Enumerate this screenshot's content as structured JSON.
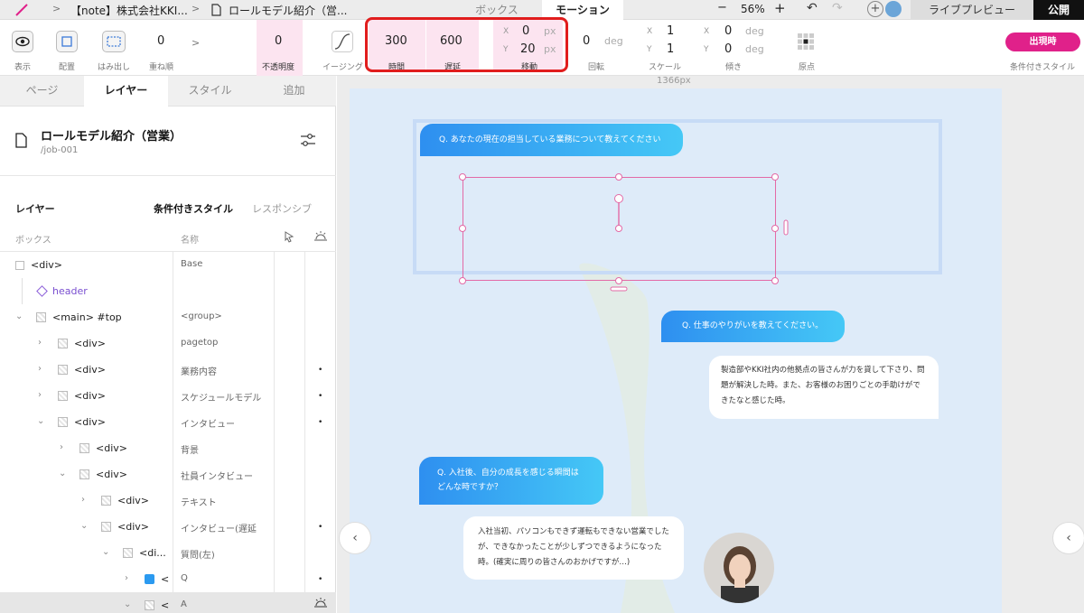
{
  "topbar": {
    "project": "【note】株式会社KKI...",
    "page_title": "ロールモデル紹介（営...",
    "tab_box": "ボックス",
    "tab_motion": "モーション",
    "zoom": "56%",
    "zoom_minus": "−",
    "zoom_plus": "+",
    "live_preview": "ライブプレビュー",
    "publish": "公開"
  },
  "toolbar": {
    "display": "表示",
    "placement": "配置",
    "overflow": "はみ出し",
    "stack_value": "0",
    "stack_label": "重ね順",
    "opacity_value": "0",
    "opacity_label": "不透明度",
    "easing_label": "イージング",
    "duration_value": "300",
    "duration_label": "時間",
    "delay_value": "600",
    "delay_label": "遅延",
    "move_x": "0",
    "move_y": "20",
    "move_label": "移動",
    "px": "px",
    "x": "X",
    "y": "Y",
    "rotate_value": "0",
    "rotate_unit": "deg",
    "rotate_label": "回転",
    "scale_x": "1",
    "scale_y": "1",
    "scale_label": "スケール",
    "skew_x": "0",
    "skew_y": "0",
    "skew_unit": "deg",
    "skew_label": "傾き",
    "origin_label": "原点",
    "appear_button": "出現時",
    "cond_style_label": "条件付きスタイル"
  },
  "panel": {
    "tabs": [
      "ページ",
      "レイヤー",
      "スタイル",
      "追加"
    ],
    "page_name": "ロールモデル紹介（営業）",
    "page_path": "/job-001",
    "layer_heading": "レイヤー",
    "cond_style": "条件付きスタイル",
    "responsive": "レスポンシブ",
    "col_box": "ボックス",
    "col_name": "名称",
    "layers": [
      {
        "name": "<div>",
        "style": "Base",
        "dot": ""
      },
      {
        "name": "header",
        "style": "",
        "dot": ""
      },
      {
        "name": "<main> #top",
        "style": "<group>",
        "dot": ""
      },
      {
        "name": "<div>",
        "style": "pagetop",
        "dot": ""
      },
      {
        "name": "<div>",
        "style": "業務内容",
        "dot": "•"
      },
      {
        "name": "<div>",
        "style": "スケジュールモデル",
        "dot": "•"
      },
      {
        "name": "<div>",
        "style": "インタビュー",
        "dot": "•"
      },
      {
        "name": "<div>",
        "style": "背景",
        "dot": ""
      },
      {
        "name": "<div>",
        "style": "社員インタビュー",
        "dot": ""
      },
      {
        "name": "<div>",
        "style": "テキスト",
        "dot": ""
      },
      {
        "name": "<div>",
        "style": "インタビュー(遅延",
        "dot": "•"
      },
      {
        "name": "<di...",
        "style": "質問(左)",
        "dot": ""
      },
      {
        "name": "<",
        "style": "Q",
        "dot": "•"
      },
      {
        "name": "<",
        "style": "A",
        "dot": ""
      }
    ]
  },
  "canvas": {
    "width_label": "1366px",
    "q1": "Q. あなたの現在の担当している業務について教えてください",
    "q2": "Q. 仕事のやりがいを教えてください。",
    "a2": "製造部やKKI社内の他拠点の皆さんが力を貸して下さり、問題が解決した時。また、お客様のお困りごとの手助けができたなと感じた時。",
    "q3": "Q. 入社後、自分の成長を感じる瞬間はどんな時ですか？",
    "a3": "入社当初、パソコンもできず運転もできない営業でしたが、できなかったことが少しずつできるようになった時。(確実に周りの皆さんのおかげですが…)"
  },
  "colors": {
    "accent": "#e0218a",
    "highlight": "#e11d1d",
    "selection": "#e36aa6"
  }
}
